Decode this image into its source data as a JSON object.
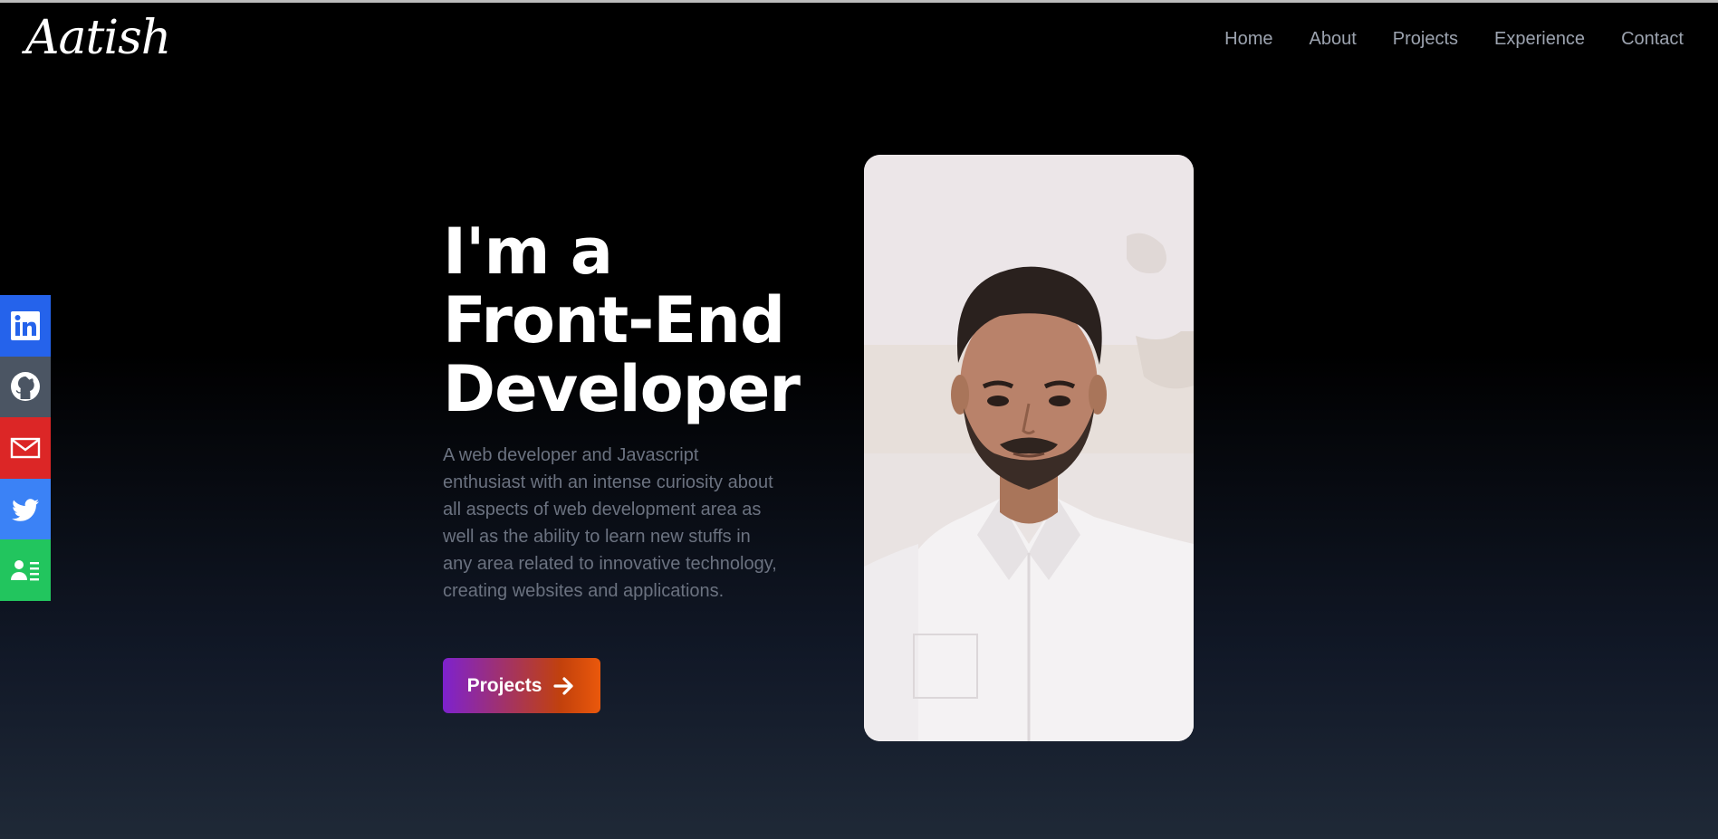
{
  "header": {
    "logo_text": "Aatish",
    "nav": [
      {
        "label": "Home"
      },
      {
        "label": "About"
      },
      {
        "label": "Projects"
      },
      {
        "label": "Experience"
      },
      {
        "label": "Contact"
      }
    ]
  },
  "social": [
    {
      "name": "linkedin",
      "icon": "linkedin-icon",
      "color": "#2563eb"
    },
    {
      "name": "github",
      "icon": "github-icon",
      "color": "#4b5563"
    },
    {
      "name": "mail",
      "icon": "mail-icon",
      "color": "#dc2626"
    },
    {
      "name": "twitter",
      "icon": "twitter-icon",
      "color": "#3b82f6"
    },
    {
      "name": "resume",
      "icon": "resume-icon",
      "color": "#22c55e"
    }
  ],
  "hero": {
    "headline_lines": [
      "I'm a",
      "Front-End",
      "Developer"
    ],
    "description": "A web developer and Javascript enthusiast with an intense curiosity about all aspects of web development area as well as the ability to learn new stuffs in any area related to innovative technology, creating websites and applications.",
    "cta_label": "Projects",
    "cta_icon": "arrow-right-icon"
  },
  "portrait": {
    "icon": "profile-photo"
  },
  "colors": {
    "background_top": "#000000",
    "background_bottom": "#1f2937",
    "cta_gradient_start": "#7e22ce",
    "cta_gradient_end": "#ea580c"
  }
}
